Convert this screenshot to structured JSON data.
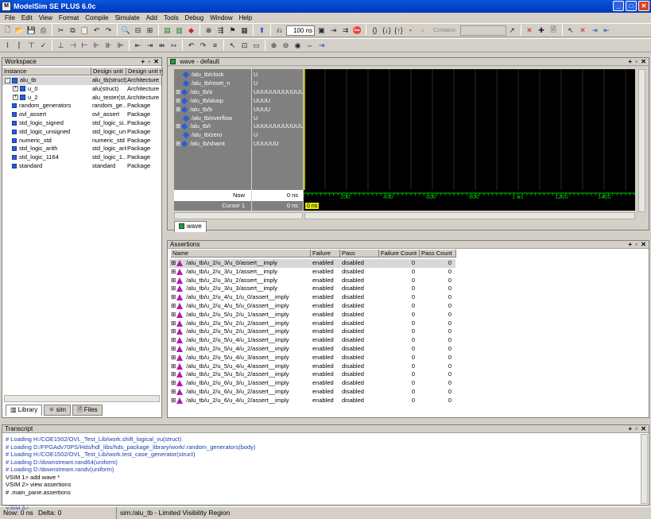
{
  "app": {
    "title": "ModelSim SE PLUS 6.0c"
  },
  "menu": [
    "File",
    "Edit",
    "View",
    "Format",
    "Compile",
    "Simulate",
    "Add",
    "Tools",
    "Debug",
    "Window",
    "Help"
  ],
  "toolbar": {
    "run_length": "100 ns",
    "contains_label": "Contains:"
  },
  "workspace": {
    "title": "Workspace",
    "columns": [
      "Instance",
      "Design unit",
      "Design unit ty"
    ],
    "rows": [
      {
        "name": "alu_tb",
        "unit": "alu_tb(struct)",
        "type": "Architecture",
        "level": 0,
        "expand": "-",
        "selected": true
      },
      {
        "name": "u_0",
        "unit": "alu(struct)",
        "type": "Architecture",
        "level": 1,
        "expand": "+"
      },
      {
        "name": "u_2",
        "unit": "alu_tester(st...",
        "type": "Architecture",
        "level": 1,
        "expand": "+"
      },
      {
        "name": "random_generators",
        "unit": "random_ge...",
        "type": "Package",
        "level": 0,
        "expand": ""
      },
      {
        "name": "ovl_assert",
        "unit": "ovl_assert",
        "type": "Package",
        "level": 0,
        "expand": ""
      },
      {
        "name": "std_logic_signed",
        "unit": "std_logic_si...",
        "type": "Package",
        "level": 0,
        "expand": ""
      },
      {
        "name": "std_logic_unsigned",
        "unit": "std_logic_un...",
        "type": "Package",
        "level": 0,
        "expand": ""
      },
      {
        "name": "numeric_std",
        "unit": "numeric_std",
        "type": "Package",
        "level": 0,
        "expand": ""
      },
      {
        "name": "std_logic_arith",
        "unit": "std_logic_arith",
        "type": "Package",
        "level": 0,
        "expand": ""
      },
      {
        "name": "std_logic_1164",
        "unit": "std_logic_1...",
        "type": "Package",
        "level": 0,
        "expand": ""
      },
      {
        "name": "standard",
        "unit": "standard",
        "type": "Package",
        "level": 0,
        "expand": ""
      }
    ],
    "tabs": [
      "Library",
      "sim",
      "Files"
    ]
  },
  "wave": {
    "title": "wave - default",
    "signals": [
      {
        "name": "/alu_tb/clock",
        "value": "U",
        "expand": ""
      },
      {
        "name": "/alu_tb/reset_n",
        "value": "U",
        "expand": ""
      },
      {
        "name": "/alu_tb/a",
        "value": "UUUUUUUUUUUUU",
        "expand": "+"
      },
      {
        "name": "/alu_tb/aluop",
        "value": "UUUU",
        "expand": "+"
      },
      {
        "name": "/alu_tb/b",
        "value": "UUUU",
        "expand": "+"
      },
      {
        "name": "/alu_tb/overflow",
        "value": "U",
        "expand": ""
      },
      {
        "name": "/alu_tb/r",
        "value": "UUUUUUUUUUUUU",
        "expand": "+"
      },
      {
        "name": "/alu_tb/zero",
        "value": "U",
        "expand": ""
      },
      {
        "name": "/alu_tb/shamt",
        "value": "UUUUUU",
        "expand": "+"
      }
    ],
    "now_label": "Now",
    "now_value": "0 ns",
    "cursor_label": "Cursor 1",
    "cursor_value": "0 ns",
    "cursor_tag": "0 ns",
    "ticks": [
      "200",
      "400",
      "600",
      "800",
      "1 us",
      "1200",
      "1400"
    ],
    "tab": "wave",
    "accent": "#00c800",
    "cursor_color": "#e8e800"
  },
  "assertions": {
    "title": "Assertions",
    "columns": [
      "Name",
      "Failure",
      "Pass",
      "Failure Count",
      "Pass Count"
    ],
    "rows": [
      {
        "name": "/alu_tb/u_2/u_3/u_0/assert__imply",
        "failure": "enabled",
        "pass": "disabled",
        "fc": "0",
        "pc": "0"
      },
      {
        "name": "/alu_tb/u_2/u_3/u_1/assert__imply",
        "failure": "enabled",
        "pass": "disabled",
        "fc": "0",
        "pc": "0"
      },
      {
        "name": "/alu_tb/u_2/u_3/u_2/assert__imply",
        "failure": "enabled",
        "pass": "disabled",
        "fc": "0",
        "pc": "0"
      },
      {
        "name": "/alu_tb/u_2/u_3/u_3/assert__imply",
        "failure": "enabled",
        "pass": "disabled",
        "fc": "0",
        "pc": "0"
      },
      {
        "name": "/alu_tb/u_2/u_4/u_1/u_0/assert__imply",
        "failure": "enabled",
        "pass": "disabled",
        "fc": "0",
        "pc": "0"
      },
      {
        "name": "/alu_tb/u_2/u_4/u_5/u_0/assert__imply",
        "failure": "enabled",
        "pass": "disabled",
        "fc": "0",
        "pc": "0"
      },
      {
        "name": "/alu_tb/u_2/u_5/u_2/u_1/assert__imply",
        "failure": "enabled",
        "pass": "disabled",
        "fc": "0",
        "pc": "0"
      },
      {
        "name": "/alu_tb/u_2/u_5/u_2/u_2/assert__imply",
        "failure": "enabled",
        "pass": "disabled",
        "fc": "0",
        "pc": "0"
      },
      {
        "name": "/alu_tb/u_2/u_5/u_2/u_3/assert__imply",
        "failure": "enabled",
        "pass": "disabled",
        "fc": "0",
        "pc": "0"
      },
      {
        "name": "/alu_tb/u_2/u_5/u_4/u_1/assert__imply",
        "failure": "enabled",
        "pass": "disabled",
        "fc": "0",
        "pc": "0"
      },
      {
        "name": "/alu_tb/u_2/u_5/u_4/u_2/assert__imply",
        "failure": "enabled",
        "pass": "disabled",
        "fc": "0",
        "pc": "0"
      },
      {
        "name": "/alu_tb/u_2/u_5/u_4/u_3/assert__imply",
        "failure": "enabled",
        "pass": "disabled",
        "fc": "0",
        "pc": "0"
      },
      {
        "name": "/alu_tb/u_2/u_5/u_4/u_4/assert__imply",
        "failure": "enabled",
        "pass": "disabled",
        "fc": "0",
        "pc": "0"
      },
      {
        "name": "/alu_tb/u_2/u_5/u_5/u_2/assert__imply",
        "failure": "enabled",
        "pass": "disabled",
        "fc": "0",
        "pc": "0"
      },
      {
        "name": "/alu_tb/u_2/u_6/u_3/u_1/assert__imply",
        "failure": "enabled",
        "pass": "disabled",
        "fc": "0",
        "pc": "0"
      },
      {
        "name": "/alu_tb/u_2/u_6/u_3/u_2/assert__imply",
        "failure": "enabled",
        "pass": "disabled",
        "fc": "0",
        "pc": "0"
      },
      {
        "name": "/alu_tb/u_2/u_6/u_4/u_2/assert__imply",
        "failure": "enabled",
        "pass": "disabled",
        "fc": "0",
        "pc": "0"
      }
    ]
  },
  "transcript": {
    "title": "Transcript",
    "lines": [
      {
        "text": "# Loading H:/COE1502/OVL_Test_Lib/work.shift_logical_vu(struct)",
        "blue": true
      },
      {
        "text": "# Loading D:/FPGAdv70PS/Hds/hdl_libs/hds_package_library/work/.random_generators(body)",
        "blue": true
      },
      {
        "text": "# Loading H:/COE1502/OVL_Test_Lib/work.test_case_generator(struct)",
        "blue": true
      },
      {
        "text": "# Loading D:/downstream.rand64(uniform)",
        "blue": true
      },
      {
        "text": "# Loading D:/downstream.randv(uniform)",
        "blue": true
      },
      {
        "text": "VSIM 1> add wave *",
        "blue": false
      },
      {
        "text": "VSIM 2> view assertions",
        "blue": false
      },
      {
        "text": "# .main_pane.assertions",
        "blue": false
      },
      {
        "text": "",
        "blue": false
      },
      {
        "text": "VSIM 3>",
        "blue": true
      }
    ]
  },
  "status": {
    "now": "Now: 0 ns",
    "delta": "Delta: 0",
    "region": "sim:/alu_tb - Limited Visibility Region"
  }
}
